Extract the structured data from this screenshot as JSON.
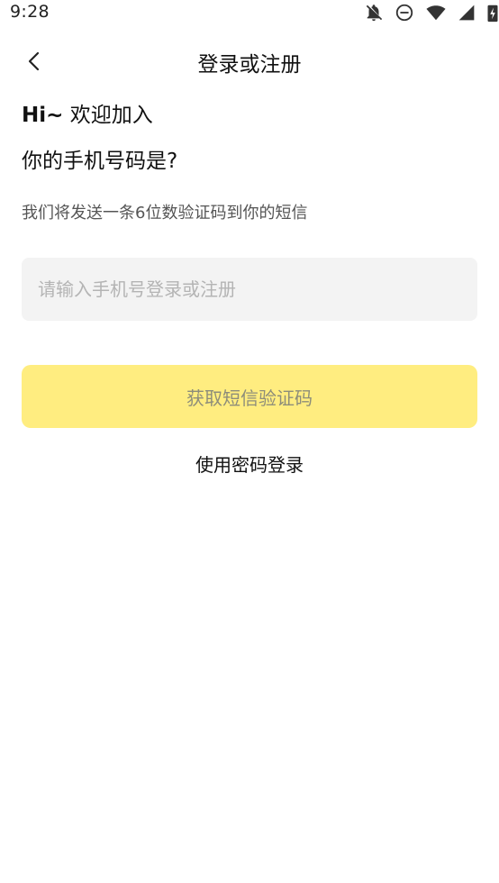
{
  "status_bar": {
    "time": "9:28",
    "icons": [
      "bell-off-icon",
      "do-not-disturb-icon",
      "wifi-icon",
      "signal-icon",
      "battery-charging-icon"
    ]
  },
  "nav": {
    "title": "登录或注册",
    "back_icon": "chevron-left-icon"
  },
  "greeting": {
    "hi": "Hi~",
    "welcome": " 欢迎加入"
  },
  "question": "你的手机号码是?",
  "hint": "我们将发送一条6位数验证码到你的短信",
  "phone_input": {
    "value": "",
    "placeholder": "请输入手机号登录或注册"
  },
  "sms_button": {
    "label": "获取短信验证码"
  },
  "password_login": {
    "label": "使用密码登录"
  },
  "colors": {
    "accent_disabled": "#ffed80",
    "input_bg": "#f3f3f3",
    "placeholder": "#b4b4b4"
  }
}
